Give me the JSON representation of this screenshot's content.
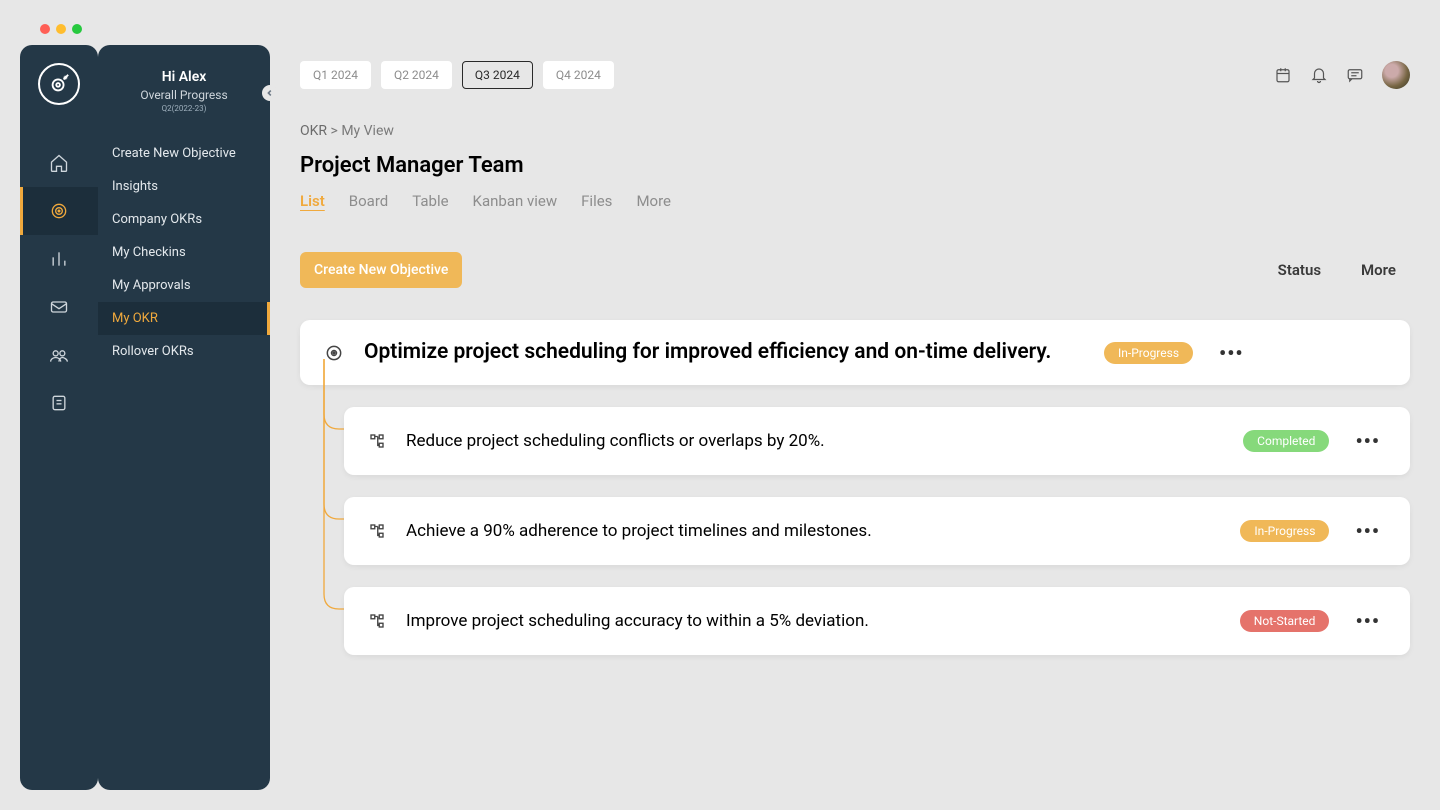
{
  "sidebar": {
    "greeting": "Hi Alex",
    "subtitle": "Overall Progress",
    "period": "Q2(2022-23)",
    "items": [
      {
        "label": "Create New Objective"
      },
      {
        "label": "Insights"
      },
      {
        "label": "Company OKRs"
      },
      {
        "label": "My  Checkins"
      },
      {
        "label": "My Approvals"
      },
      {
        "label": "My OKR"
      },
      {
        "label": "Rollover OKRs"
      }
    ],
    "activeIndex": 5
  },
  "quarters": [
    "Q1 2024",
    "Q2 2024",
    "Q3 2024",
    "Q4 2024"
  ],
  "activeQuarter": 2,
  "breadcrumb": {
    "root": "OKR",
    "leaf": "My View"
  },
  "pageTitle": "Project Manager Team",
  "viewTabs": [
    "List",
    "Board",
    "Table",
    "Kanban view",
    "Files",
    "More"
  ],
  "activeViewTab": 0,
  "createButton": "Create New Objective",
  "columnHeaders": {
    "status": "Status",
    "more": "More"
  },
  "objective": {
    "title": "Optimize project scheduling for improved efficiency and on-time delivery.",
    "status": "In-Progress",
    "statusClass": "st-inprogress"
  },
  "keyResults": [
    {
      "title": "Reduce project scheduling conflicts or overlaps by 20%.",
      "status": "Completed",
      "statusClass": "st-completed"
    },
    {
      "title": "Achieve a 90% adherence to project timelines and milestones.",
      "status": "In-Progress",
      "statusClass": "st-inprogress"
    },
    {
      "title": "Improve project scheduling accuracy to within a 5% deviation.",
      "status": "Not-Started",
      "statusClass": "st-notstarted"
    }
  ],
  "colors": {
    "accent": "#f0a93d",
    "railBg": "#243847"
  }
}
